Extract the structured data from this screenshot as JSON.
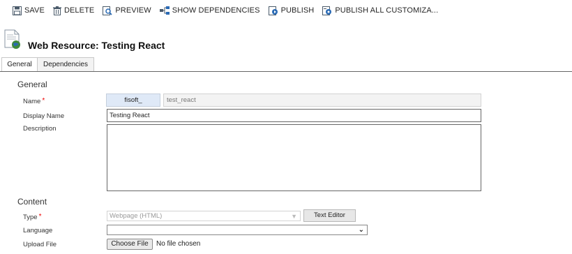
{
  "toolbar": {
    "save_label": "SAVE",
    "delete_label": "DELETE",
    "preview_label": "PREVIEW",
    "show_dependencies_label": "SHOW DEPENDENCIES",
    "publish_label": "PUBLISH",
    "publish_all_label": "PUBLISH ALL CUSTOMIZA..."
  },
  "header": {
    "title": "Web Resource: Testing React"
  },
  "tabs": [
    {
      "label": "General",
      "active": true
    },
    {
      "label": "Dependencies",
      "active": false
    }
  ],
  "general": {
    "section_title": "General",
    "name_label": "Name",
    "name_prefix": "fisoft_",
    "name_value": "test_react",
    "display_name_label": "Display Name",
    "display_name_value": "Testing React",
    "description_label": "Description",
    "description_value": ""
  },
  "content": {
    "section_title": "Content",
    "type_label": "Type",
    "type_value": "Webpage (HTML)",
    "text_editor_label": "Text Editor",
    "language_label": "Language",
    "language_value": "",
    "upload_label": "Upload File",
    "choose_file_label": "Choose File",
    "no_file_text": "No file chosen"
  },
  "required_marker": "*",
  "colors": {
    "required": "#ee0000",
    "prefix_bg": "#dfe9f7"
  }
}
